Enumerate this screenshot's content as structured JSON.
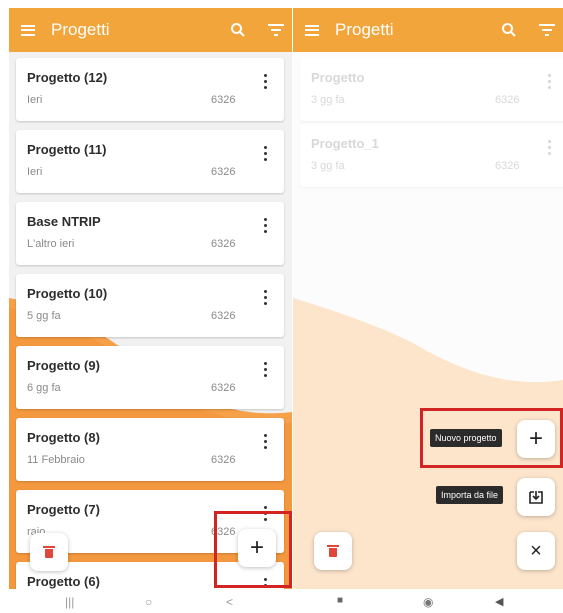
{
  "left": {
    "title": "Progetti",
    "projects": [
      {
        "name": "Progetto (12)",
        "date": "Ieri",
        "size": "6326"
      },
      {
        "name": "Progetto (11)",
        "date": "Ieri",
        "size": "6326"
      },
      {
        "name": "Base NTRIP",
        "date": "L'altro ieri",
        "size": "6326"
      },
      {
        "name": "Progetto (10)",
        "date": "5 gg fa",
        "size": "6326"
      },
      {
        "name": "Progetto (9)",
        "date": "6 gg fa",
        "size": "6326"
      },
      {
        "name": "Progetto (8)",
        "date": "11 Febbraio",
        "size": "6326"
      },
      {
        "name": "Progetto (7)",
        "date": "raio",
        "size": "6326"
      },
      {
        "name": "Progetto (6)",
        "date": "",
        "size": ""
      }
    ],
    "add_label": "+"
  },
  "right": {
    "title": "Progetti",
    "projects": [
      {
        "name": "Progetto",
        "date": "3 gg fa",
        "size": "6326"
      },
      {
        "name": "Progetto_1",
        "date": "3 gg fa",
        "size": "6326"
      }
    ],
    "new_project_tooltip": "Nuovo progetto",
    "import_tooltip": "Importa da file",
    "add_label": "+",
    "close_label": "×"
  },
  "icons": {
    "menu": "menu-icon",
    "search": "search-icon",
    "filter": "filter-icon",
    "more": "more-vertical-icon",
    "delete": "trash-icon",
    "import": "import-file-icon"
  },
  "colors": {
    "appbar": "#f1a53a",
    "accent_shape": "#f5a04a",
    "highlight": "#d32424",
    "delete": "#e0463a"
  }
}
